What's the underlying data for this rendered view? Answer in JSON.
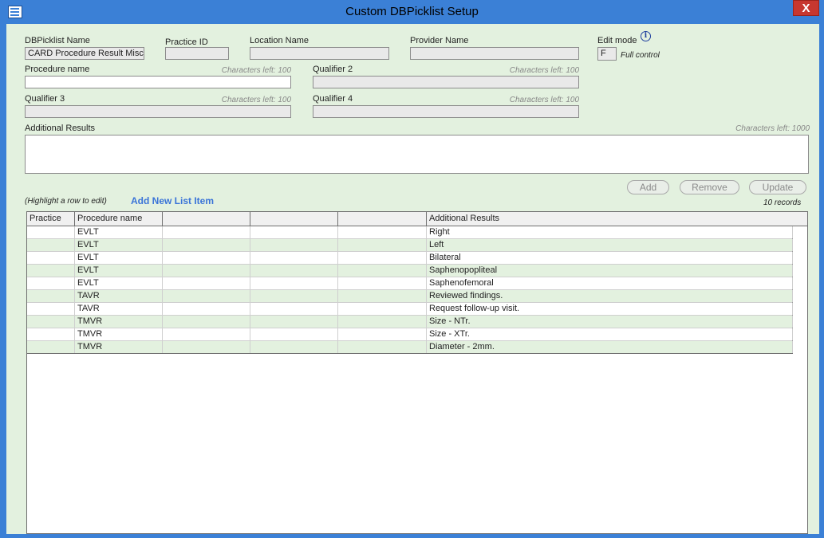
{
  "window": {
    "title": "Custom DBPicklist Setup",
    "close_glyph": "X"
  },
  "fields": {
    "dbpicklist_name_label": "DBPicklist Name",
    "dbpicklist_name_value": "CARD Procedure Result Misc",
    "practice_id_label": "Practice ID",
    "location_name_label": "Location Name",
    "provider_name_label": "Provider Name",
    "edit_mode_label": "Edit mode",
    "edit_mode_value": "F",
    "edit_mode_desc": "Full control",
    "procedure_name_label": "Procedure name",
    "procedure_name_hint": "Characters left: 100",
    "qualifier2_label": "Qualifier 2",
    "qualifier2_hint": "Characters left: 100",
    "qualifier3_label": "Qualifier 3",
    "qualifier3_hint": "Characters left: 100",
    "qualifier4_label": "Qualifier 4",
    "qualifier4_hint": "Characters left: 100",
    "additional_results_label": "Additional Results",
    "additional_results_hint": "Characters left: 1000"
  },
  "actions": {
    "highlight_hint": "(Highlight a row to edit)",
    "add_new": "Add New List Item",
    "add": "Add",
    "remove": "Remove",
    "update": "Update",
    "record_count": "10 records"
  },
  "grid": {
    "headers": [
      "Practice",
      "Procedure name",
      "",
      "",
      "",
      "Additional Results"
    ],
    "rows": [
      {
        "practice": "",
        "procedure": "EVLT",
        "result": "Right"
      },
      {
        "practice": "",
        "procedure": "EVLT",
        "result": "Left"
      },
      {
        "practice": "",
        "procedure": "EVLT",
        "result": "Bilateral"
      },
      {
        "practice": "",
        "procedure": "EVLT",
        "result": "Saphenopopliteal"
      },
      {
        "practice": "",
        "procedure": "EVLT",
        "result": "Saphenofemoral"
      },
      {
        "practice": "",
        "procedure": "TAVR",
        "result": "Reviewed findings."
      },
      {
        "practice": "",
        "procedure": "TAVR",
        "result": "Request follow-up visit."
      },
      {
        "practice": "",
        "procedure": "TMVR",
        "result": "Size - NTr."
      },
      {
        "practice": "",
        "procedure": "TMVR",
        "result": "Size - XTr."
      },
      {
        "practice": "",
        "procedure": "TMVR",
        "result": "Diameter - 2mm."
      }
    ]
  },
  "colors": {
    "row_alt": "#e3f1df",
    "accent": "#3a74d8",
    "titlebar": "#3b80d6"
  }
}
